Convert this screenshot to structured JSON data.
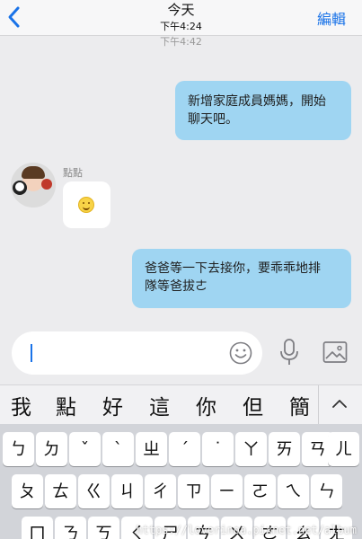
{
  "nav": {
    "title": "今天",
    "subtitle": "下午4:24",
    "edit_label": "編輯",
    "scrolled_time": "下午4:42"
  },
  "messages": [
    {
      "side": "right",
      "text_lines": [
        "新增家庭成員媽媽，開始",
        "聊天吧。"
      ]
    },
    {
      "side": "left",
      "sender": "點點",
      "content": "smile-emoji-sticker"
    },
    {
      "side": "right",
      "text_lines": [
        "爸爸等一下去接你，要乖乖地排",
        "隊等爸拔ㄜ"
      ]
    }
  ],
  "input": {
    "value": "",
    "icons": [
      "emoji-icon",
      "microphone-icon",
      "photo-icon"
    ]
  },
  "candidates": [
    "我",
    "點",
    "好",
    "這",
    "你",
    "但",
    "簡"
  ],
  "keyboard": {
    "row1": [
      "ㄅ",
      "ㄉ",
      "ˇ",
      "ˋ",
      "ㄓ",
      "ˊ",
      "˙",
      "ㄚ",
      "ㄞ",
      "ㄢ",
      "ㄦ"
    ],
    "row2": [
      "ㄆ",
      "ㄊ",
      "ㄍ",
      "ㄐ",
      "ㄔ",
      "ㄗ",
      "ㄧ",
      "ㄛ",
      "ㄟ",
      "ㄣ"
    ],
    "row3": [
      "ㄇ",
      "ㄋ",
      "ㄎ",
      "ㄑ",
      "ㄕ",
      "ㄘ",
      "ㄨ",
      "ㄜ",
      "ㄠ",
      "ㄤ"
    ]
  },
  "watermark": "https://loverinoa.pixnet.net/album",
  "colors": {
    "accent": "#1a73e8",
    "bubble_self": "#9fd5f2",
    "background": "#ececee"
  }
}
